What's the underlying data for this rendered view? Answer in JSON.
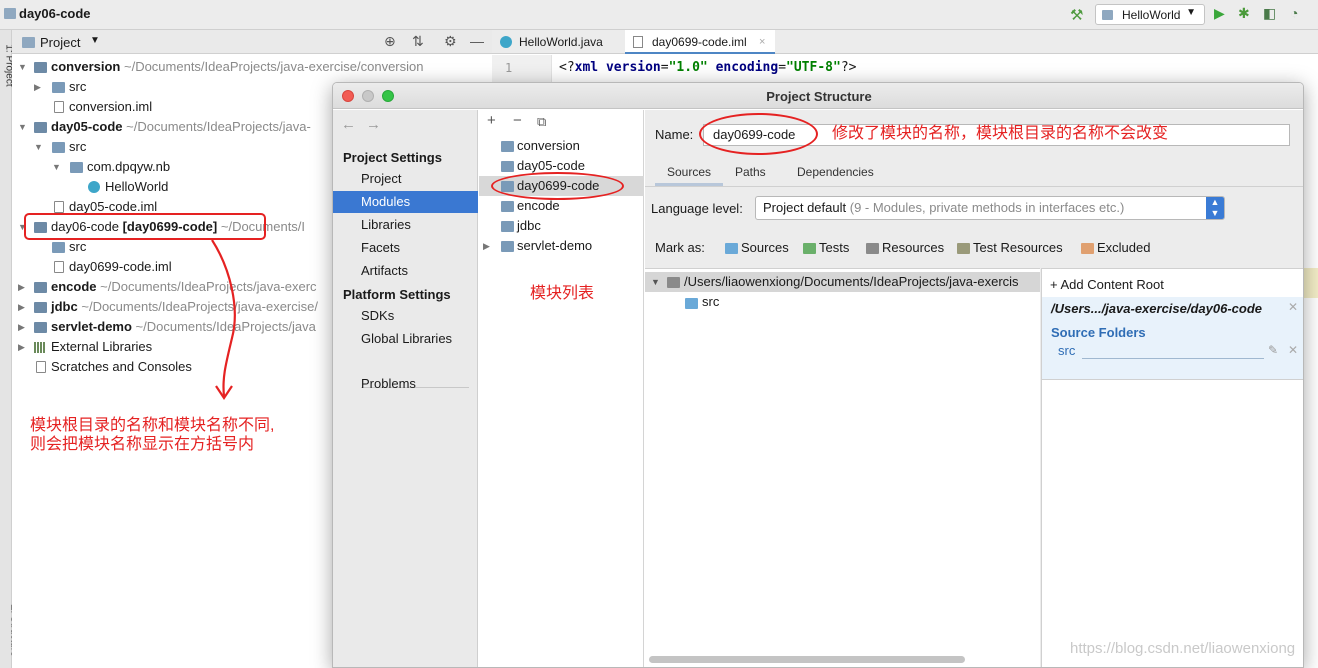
{
  "app": {
    "project_title": "day06-code",
    "run_config": "HelloWorld"
  },
  "stripe": {
    "project_label": "1: Project",
    "structure_label": "Z: Structure"
  },
  "project_panel": {
    "header_label": "Project",
    "tree": [
      {
        "name": "conversion",
        "path": "~/Documents/IdeaProjects/java-exercise/conversion"
      },
      {
        "name": "src"
      },
      {
        "name": "conversion.iml"
      },
      {
        "name": "day05-code",
        "path": "~/Documents/IdeaProjects/java-"
      },
      {
        "name": "src"
      },
      {
        "name": "com.dpqyw.nb"
      },
      {
        "name": "HelloWorld"
      },
      {
        "name": "day05-code.iml"
      },
      {
        "name": "day06-code",
        "module": "[day0699-code]",
        "path": "~/Documents/I"
      },
      {
        "name": "src"
      },
      {
        "name": "day0699-code.iml"
      },
      {
        "name": "encode",
        "path": "~/Documents/IdeaProjects/java-exerc"
      },
      {
        "name": "jdbc",
        "path": "~/Documents/IdeaProjects/java-exercise/"
      },
      {
        "name": "servlet-demo",
        "path": "~/Documents/IdeaProjects/java"
      },
      {
        "name": "External Libraries"
      },
      {
        "name": "Scratches and Consoles"
      }
    ]
  },
  "editor": {
    "tabs": [
      "HelloWorld.java",
      "day0699-code.iml"
    ],
    "line_number": "1",
    "code": {
      "open": "<?",
      "tag": "xml",
      "attr1": "version",
      "eq1": "=",
      "val1": "\"1.0\"",
      "attr2": "encoding",
      "eq2": "=",
      "val2": "\"UTF-8\"",
      "close": "?>"
    }
  },
  "dialog": {
    "title": "Project Structure",
    "nav": {
      "project_settings": "Project Settings",
      "items1": [
        "Project",
        "Modules",
        "Libraries",
        "Facets",
        "Artifacts"
      ],
      "platform_settings": "Platform Settings",
      "items2": [
        "SDKs",
        "Global Libraries"
      ],
      "problems": "Problems",
      "selected": "Modules"
    },
    "modules": [
      "conversion",
      "day05-code",
      "day0699-code",
      "encode",
      "jdbc",
      "servlet-demo"
    ],
    "detail": {
      "name_label": "Name:",
      "name_value": "day0699-code",
      "tabs": [
        "Sources",
        "Paths",
        "Dependencies"
      ],
      "language_label": "Language level:",
      "language_value": "Project default",
      "language_hint": "(9 - Modules, private methods in interfaces etc.)",
      "mark_as": "Mark as:",
      "mark_items": [
        {
          "label": "Sources",
          "color": "#6aa9d8"
        },
        {
          "label": "Tests",
          "color": "#6ab06a"
        },
        {
          "label": "Resources",
          "color": "#8a8a8a"
        },
        {
          "label": "Test Resources",
          "color": "#9a9a7a"
        },
        {
          "label": "Excluded",
          "color": "#e0a070"
        }
      ],
      "content_root_path": "/Users/liaowenxiong/Documents/IdeaProjects/java-exercis",
      "content_src": "src",
      "add_content_root": "+ Add Content Root",
      "root_short": "/Users.../java-exercise/day06-code",
      "source_folders": "Source Folders",
      "source_item": "src"
    }
  },
  "annotations": {
    "name_note": "修改了模块的名称，模块根目录的名称不会改变",
    "list_note": "模块列表",
    "tree_note_1": "模块根目录的名称和模块名称不同,",
    "tree_note_2": "则会把模块名称显示在方括号内"
  },
  "watermark": "https://blog.csdn.net/liaowenxiong",
  "colors": {
    "annotation": "#e52222",
    "selection": "#3a78d2"
  }
}
